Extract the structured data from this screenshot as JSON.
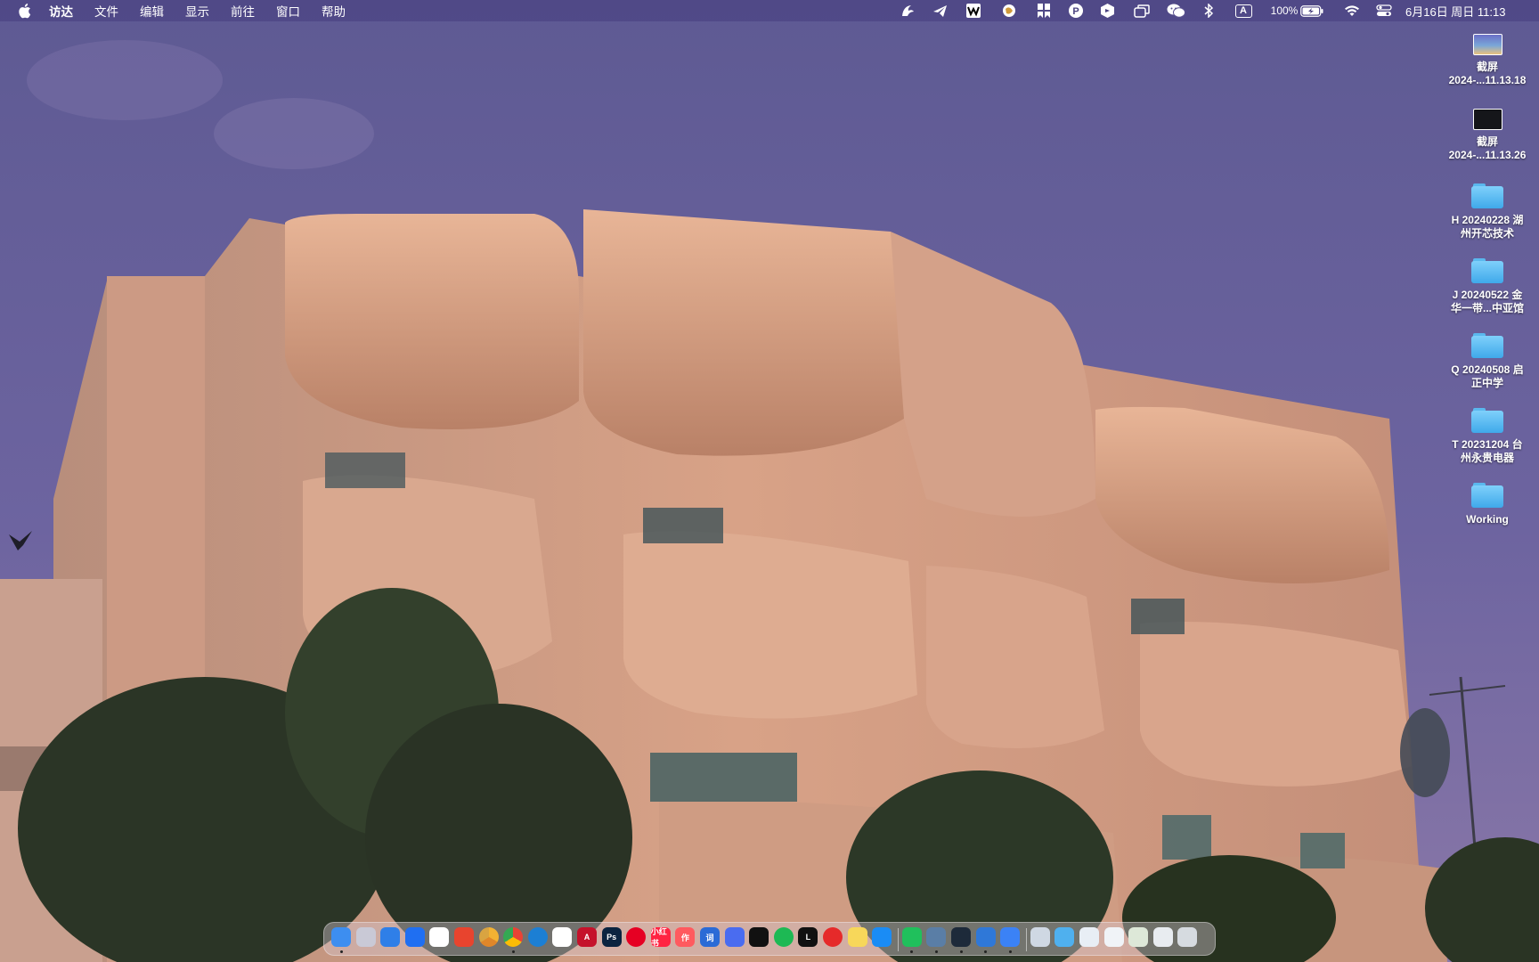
{
  "menubar": {
    "apple": "",
    "app_name": "访达",
    "menus": [
      "文件",
      "编辑",
      "显示",
      "前往",
      "窗口",
      "帮助"
    ],
    "input_method": "A",
    "battery": "100%",
    "datetime": "6月16日 周日 11:13",
    "status_icons": [
      "arc-icon",
      "paper-plane-icon",
      "wps-icon",
      "vpn-globe-icon",
      "bookmark-grid-icon",
      "p-badge-icon",
      "cube-icon",
      "window-stack-icon",
      "wechat-icon",
      "bluetooth-icon",
      "input-source-icon",
      "battery-icon",
      "wifi-icon",
      "control-center-icon"
    ]
  },
  "desktop": {
    "items": [
      {
        "type": "screenshot",
        "label": "截屏\n2024-...11.13.18"
      },
      {
        "type": "screenshot",
        "label": "截屏\n2024-...11.13.26"
      },
      {
        "type": "folder",
        "label": "H 20240228 湖\n州开芯技术"
      },
      {
        "type": "folder",
        "label": "J 20240522 金\n华一带...中亚馆"
      },
      {
        "type": "folder",
        "label": "Q 20240508 启\n正中学"
      },
      {
        "type": "folder",
        "label": "T 20231204 台\n州永贵电器"
      },
      {
        "type": "folder",
        "label": "Working"
      }
    ]
  },
  "dock": {
    "apps": [
      {
        "name": "finder-icon",
        "color": "#3d8ef0",
        "running": true
      },
      {
        "name": "launchpad-icon",
        "color": "#c9c9d6",
        "running": false
      },
      {
        "name": "safari-icon",
        "color": "#2f7fe8",
        "running": false
      },
      {
        "name": "lark-icon",
        "color": "#1f6ff2",
        "running": false
      },
      {
        "name": "wps-icon",
        "color": "#ffffff",
        "running": false
      },
      {
        "name": "xmind-icon",
        "color": "#e8442e",
        "running": false
      },
      {
        "name": "chrome-canary-icon",
        "color": "#f2b233",
        "running": false
      },
      {
        "name": "chrome-icon",
        "color": "#34a853",
        "running": true
      },
      {
        "name": "edge-icon",
        "color": "#1c7fd4",
        "running": false
      },
      {
        "name": "chatgpt-icon",
        "color": "#ffffff",
        "running": false
      },
      {
        "name": "acrobat-icon",
        "color": "#c5122b",
        "running": false
      },
      {
        "name": "photoshop-icon",
        "color": "#0b2440",
        "running": false
      },
      {
        "name": "pinterest-icon",
        "color": "#e60023",
        "running": false
      },
      {
        "name": "xiaohongshu-icon",
        "color": "#ff2442",
        "running": false
      },
      {
        "name": "zuo-icon",
        "color": "#ff5a5f",
        "running": false
      },
      {
        "name": "dict-icon",
        "color": "#2b6bd6",
        "running": false
      },
      {
        "name": "alien-icon",
        "color": "#4a6cf0",
        "running": false
      },
      {
        "name": "tiktok-icon",
        "color": "#111111",
        "running": false
      },
      {
        "name": "spotify-icon",
        "color": "#1db954",
        "running": false
      },
      {
        "name": "l-icon",
        "color": "#111111",
        "running": false
      },
      {
        "name": "netease-music-icon",
        "color": "#e62a2a",
        "running": false
      },
      {
        "name": "notes-icon",
        "color": "#f7d75a",
        "running": false
      },
      {
        "name": "app-store-icon",
        "color": "#1a8cf5",
        "running": false
      },
      {
        "name": "wechat-icon",
        "color": "#20c05c",
        "running": true
      },
      {
        "name": "preview-icon",
        "color": "#5a7ea6",
        "running": true
      },
      {
        "name": "cube-icon",
        "color": "#1d2a3a",
        "running": true
      },
      {
        "name": "cloud-icon",
        "color": "#2f78d8",
        "running": true
      },
      {
        "name": "browser-icon",
        "color": "#3b82f6",
        "running": true
      },
      {
        "name": "stack-folder-icon",
        "color": "#cfd8e3",
        "running": false
      },
      {
        "name": "downloads-folder-icon",
        "color": "#4fb0ee",
        "running": false
      },
      {
        "name": "stack-keynote-icon",
        "color": "#e8eef5",
        "running": false
      },
      {
        "name": "stack-docs-icon",
        "color": "#f0f3f7",
        "running": false
      },
      {
        "name": "stack-images-icon",
        "color": "#dde8d8",
        "running": false
      },
      {
        "name": "stack-files-icon",
        "color": "#e8ecf0",
        "running": false
      },
      {
        "name": "trash-icon",
        "color": "#d6dbe0",
        "running": false
      }
    ],
    "dock_text": {
      "acrobat": "A",
      "photoshop": "Ps",
      "xiaohongshu": "小红书",
      "zuo": "作",
      "dict": "词",
      "l": "L"
    }
  }
}
